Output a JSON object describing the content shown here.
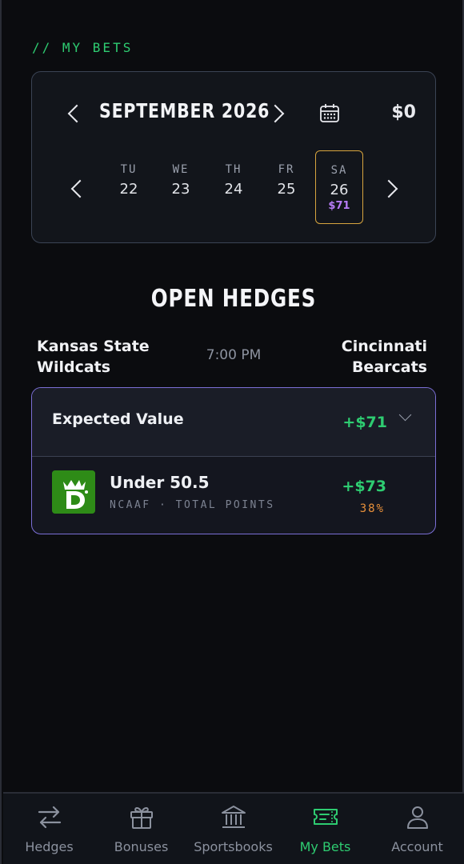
{
  "header": {
    "section_label": "// MY BETS"
  },
  "calendar": {
    "month_label": "SEPTEMBER 2026",
    "balance": "$0",
    "days": [
      {
        "dow": "TU",
        "num": "22",
        "amount": ""
      },
      {
        "dow": "WE",
        "num": "23",
        "amount": ""
      },
      {
        "dow": "TH",
        "num": "24",
        "amount": ""
      },
      {
        "dow": "FR",
        "num": "25",
        "amount": ""
      },
      {
        "dow": "SA",
        "num": "26",
        "amount": "$71",
        "selected": true
      }
    ]
  },
  "open_hedges": {
    "title": "OPEN HEDGES",
    "game": {
      "team_left": "Kansas State Wildcats",
      "time": "7:00 PM",
      "team_right": "Cincinnati Bearcats"
    },
    "expected_value": {
      "label": "Expected Value",
      "value": "+$71"
    },
    "bet": {
      "sportsbook_icon": "draftkings-logo-icon",
      "name": "Under 50.5",
      "meta": "NCAAF · TOTAL POINTS",
      "value": "+$73",
      "percent": "38%"
    }
  },
  "nav": {
    "items": [
      {
        "label": "Hedges",
        "icon": "swap-arrows-icon"
      },
      {
        "label": "Bonuses",
        "icon": "gift-icon"
      },
      {
        "label": "Sportsbooks",
        "icon": "bank-icon"
      },
      {
        "label": "My Bets",
        "icon": "ticket-icon",
        "active": true
      },
      {
        "label": "Account",
        "icon": "user-icon"
      }
    ]
  },
  "colors": {
    "accent_green": "#2ecc71",
    "accent_purple": "#b77cf7",
    "selected_border": "#d7a43e",
    "percent_orange": "#e8903a"
  }
}
